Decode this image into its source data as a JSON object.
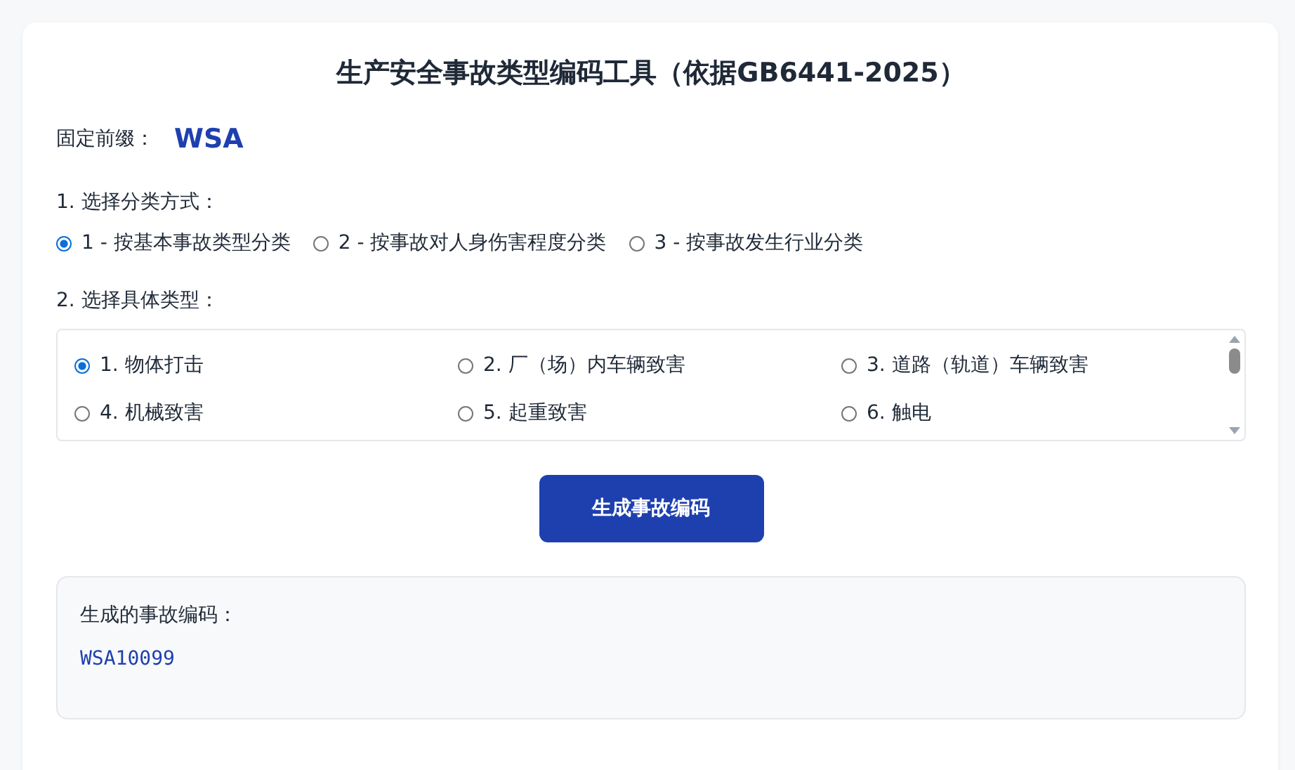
{
  "title": "生产安全事故类型编码工具（依据GB6441-2025）",
  "prefix": {
    "label": "固定前缀：",
    "value": "WSA"
  },
  "classification": {
    "label": "1. 选择分类方式：",
    "options": [
      {
        "label": "1 - 按基本事故类型分类",
        "selected": true
      },
      {
        "label": "2 - 按事故对人身伤害程度分类",
        "selected": false
      },
      {
        "label": "3 - 按事故发生行业分类",
        "selected": false
      }
    ]
  },
  "types": {
    "label": "2. 选择具体类型：",
    "options": [
      {
        "label": "1. 物体打击",
        "selected": true
      },
      {
        "label": "2. 厂（场）内车辆致害",
        "selected": false
      },
      {
        "label": "3. 道路（轨道）车辆致害",
        "selected": false
      },
      {
        "label": "4. 机械致害",
        "selected": false
      },
      {
        "label": "5. 起重致害",
        "selected": false
      },
      {
        "label": "6. 触电",
        "selected": false
      }
    ]
  },
  "generate_button": "生成事故编码",
  "result": {
    "label": "生成的事故编码：",
    "code": "WSA10099"
  }
}
